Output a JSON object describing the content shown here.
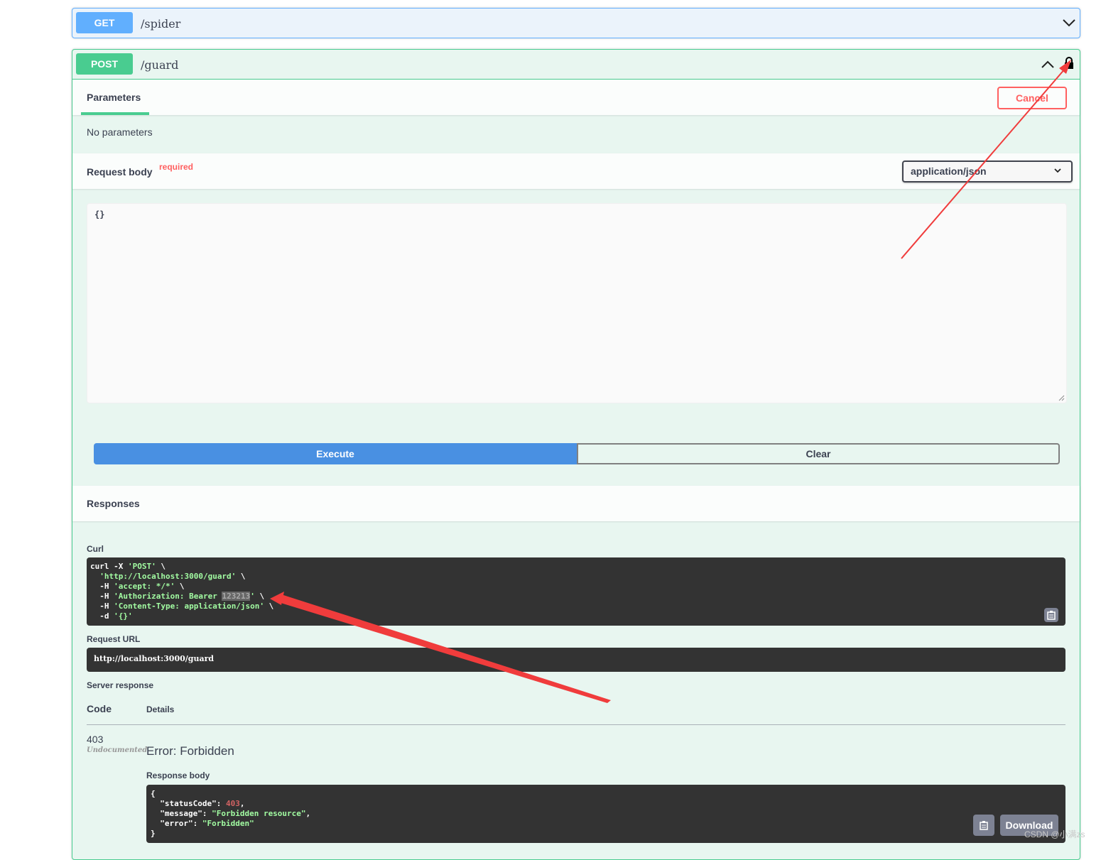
{
  "get_op": {
    "method": "GET",
    "path": "/spider"
  },
  "post_op": {
    "method": "POST",
    "path": "/guard"
  },
  "parameters": {
    "tab_label": "Parameters",
    "cancel_label": "Cancel",
    "empty_text": "No parameters"
  },
  "request_body": {
    "title": "Request body",
    "required_label": "required",
    "content_type": "application/json",
    "value": "{}"
  },
  "actions": {
    "execute_label": "Execute",
    "clear_label": "Clear"
  },
  "responses": {
    "title": "Responses",
    "curl_label": "Curl",
    "curl": {
      "cmd": "curl -X ",
      "method": "'POST'",
      "url": "'http://localhost:3000/guard'",
      "accept": "'accept: */*'",
      "auth_prefix": "'Authorization: Bearer ",
      "auth_token": "123213",
      "auth_suffix": "'",
      "content_type": "'Content-Type: application/json'",
      "data": "'{}'"
    },
    "request_url_label": "Request URL",
    "request_url": "http://localhost:3000/guard",
    "server_response_label": "Server response",
    "code_header": "Code",
    "details_header": "Details",
    "code": "403",
    "undocumented": "Undocumented",
    "error_text": "Error: Forbidden",
    "response_body_label": "Response body",
    "body": {
      "statusCode": "403",
      "message": "\"Forbidden resource\"",
      "error": "\"Forbidden\""
    },
    "download_label": "Download"
  },
  "watermark": "CSDN @小满zs",
  "colors": {
    "get": "#61affe",
    "post": "#49cc90",
    "execute": "#4990e2",
    "cancel": "#ff6060",
    "annotation_arrow": "#f03c3c"
  }
}
